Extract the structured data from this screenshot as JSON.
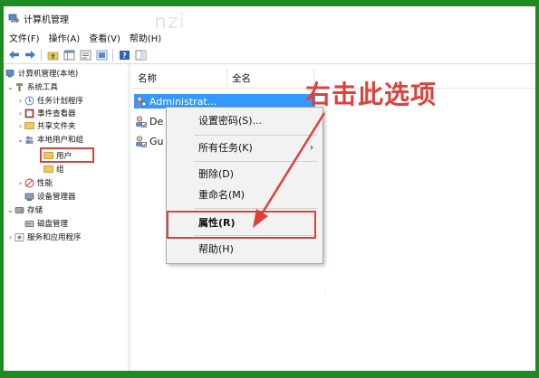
{
  "window": {
    "title": "计算机管理",
    "watermark": "nzi"
  },
  "menu": [
    "文件(F)",
    "操作(A)",
    "查看(V)",
    "帮助(H)"
  ],
  "toolbar": [
    "back-arrow-icon",
    "forward-arrow-icon",
    "up-folder-icon",
    "console-tree-icon",
    "properties-icon",
    "export-icon",
    "help-icon",
    "view-pane-icon"
  ],
  "tree": {
    "root": "计算机管理(本地)",
    "system_tools": "系统工具",
    "task_scheduler": "任务计划程序",
    "event_viewer": "事件查看器",
    "shared_folders": "共享文件夹",
    "local_users_groups": "本地用户和组",
    "users": "用户",
    "groups": "组",
    "performance": "性能",
    "device_manager": "设备管理器",
    "storage": "存储",
    "disk_management": "磁盘管理",
    "services_apps": "服务和应用程序"
  },
  "list": {
    "col_name": "名称",
    "col_fullname": "全名",
    "rows": [
      "Administrat...",
      "De",
      "Gu"
    ]
  },
  "context_menu": {
    "set_password": "设置密码(S)...",
    "all_tasks": "所有任务(K)",
    "delete": "删除(D)",
    "rename": "重命名(M)",
    "properties": "属性(R)",
    "help": "帮助(H)"
  },
  "annotation": {
    "text": "右击此选项",
    "color": "#e0403a"
  },
  "colors": {
    "border_green": "#1e8a22",
    "selection": "#3399ff",
    "highlight_red": "#e0403a"
  }
}
